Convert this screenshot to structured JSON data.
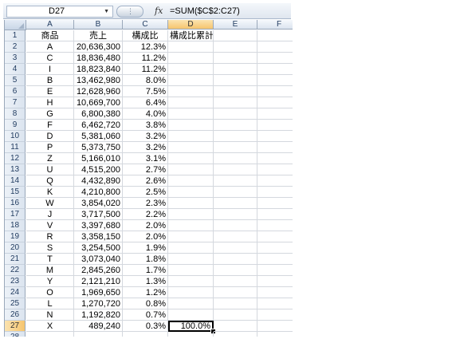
{
  "formula_bar": {
    "name_box": "D27",
    "fx_icon": "fx-icon",
    "formula": "=SUM($C$2:C27)"
  },
  "columns": [
    "A",
    "B",
    "C",
    "D",
    "E",
    "F"
  ],
  "active_column": "D",
  "active_row": 27,
  "selected_cell": "D27",
  "accent_colors": {
    "header_active": "#f6c56e",
    "gridline": "#d4d8de",
    "header_border": "#9aa8ba"
  },
  "rows": [
    {
      "n": "1",
      "a": "商品",
      "b": "売上",
      "c": "構成比",
      "d": "構成比累計"
    },
    {
      "n": "2",
      "a": "A",
      "b": "20,636,300",
      "c": "12.3%",
      "d": ""
    },
    {
      "n": "3",
      "a": "C",
      "b": "18,836,480",
      "c": "11.2%",
      "d": ""
    },
    {
      "n": "4",
      "a": "I",
      "b": "18,823,840",
      "c": "11.2%",
      "d": ""
    },
    {
      "n": "5",
      "a": "B",
      "b": "13,462,980",
      "c": "8.0%",
      "d": ""
    },
    {
      "n": "6",
      "a": "E",
      "b": "12,628,960",
      "c": "7.5%",
      "d": ""
    },
    {
      "n": "7",
      "a": "H",
      "b": "10,669,700",
      "c": "6.4%",
      "d": ""
    },
    {
      "n": "8",
      "a": "G",
      "b": "6,800,380",
      "c": "4.0%",
      "d": ""
    },
    {
      "n": "9",
      "a": "F",
      "b": "6,462,720",
      "c": "3.8%",
      "d": ""
    },
    {
      "n": "10",
      "a": "D",
      "b": "5,381,060",
      "c": "3.2%",
      "d": ""
    },
    {
      "n": "11",
      "a": "P",
      "b": "5,373,750",
      "c": "3.2%",
      "d": ""
    },
    {
      "n": "12",
      "a": "Z",
      "b": "5,166,010",
      "c": "3.1%",
      "d": ""
    },
    {
      "n": "13",
      "a": "U",
      "b": "4,515,200",
      "c": "2.7%",
      "d": ""
    },
    {
      "n": "14",
      "a": "Q",
      "b": "4,432,890",
      "c": "2.6%",
      "d": ""
    },
    {
      "n": "15",
      "a": "K",
      "b": "4,210,800",
      "c": "2.5%",
      "d": ""
    },
    {
      "n": "16",
      "a": "W",
      "b": "3,854,020",
      "c": "2.3%",
      "d": ""
    },
    {
      "n": "17",
      "a": "J",
      "b": "3,717,500",
      "c": "2.2%",
      "d": ""
    },
    {
      "n": "18",
      "a": "V",
      "b": "3,397,680",
      "c": "2.0%",
      "d": ""
    },
    {
      "n": "19",
      "a": "R",
      "b": "3,358,150",
      "c": "2.0%",
      "d": ""
    },
    {
      "n": "20",
      "a": "S",
      "b": "3,254,500",
      "c": "1.9%",
      "d": ""
    },
    {
      "n": "21",
      "a": "T",
      "b": "3,073,040",
      "c": "1.8%",
      "d": ""
    },
    {
      "n": "22",
      "a": "M",
      "b": "2,845,260",
      "c": "1.7%",
      "d": ""
    },
    {
      "n": "23",
      "a": "Y",
      "b": "2,121,210",
      "c": "1.3%",
      "d": ""
    },
    {
      "n": "24",
      "a": "O",
      "b": "1,969,650",
      "c": "1.2%",
      "d": ""
    },
    {
      "n": "25",
      "a": "L",
      "b": "1,270,720",
      "c": "0.8%",
      "d": ""
    },
    {
      "n": "26",
      "a": "N",
      "b": "1,192,820",
      "c": "0.7%",
      "d": ""
    },
    {
      "n": "27",
      "a": "X",
      "b": "489,240",
      "c": "0.3%",
      "d": "100.0%"
    },
    {
      "n": "28",
      "a": "",
      "b": "",
      "c": "",
      "d": ""
    }
  ]
}
